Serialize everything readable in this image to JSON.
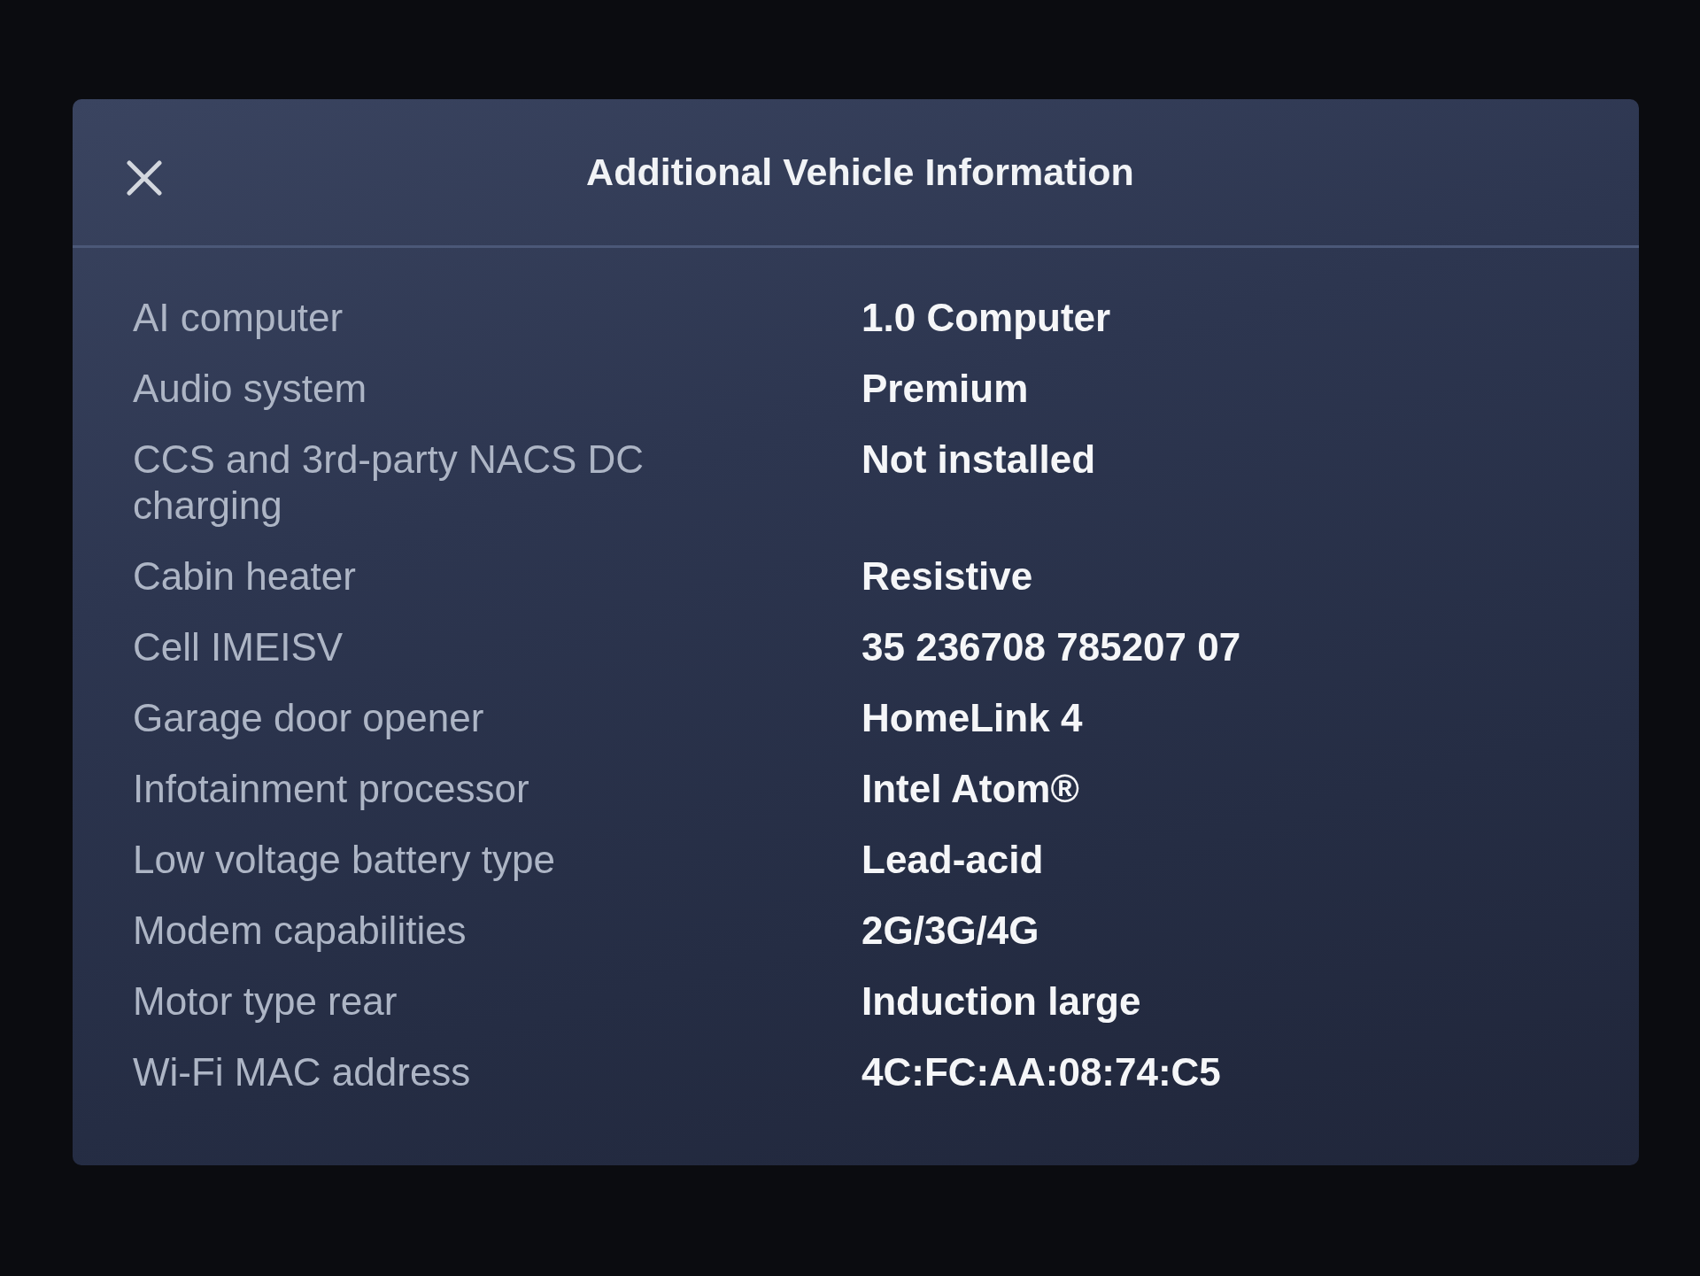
{
  "dialog": {
    "title": "Additional Vehicle Information",
    "rows": [
      {
        "label": "AI computer",
        "value": "1.0 Computer"
      },
      {
        "label": "Audio system",
        "value": "Premium"
      },
      {
        "label": "CCS and 3rd-party NACS DC charging",
        "value": "Not installed"
      },
      {
        "label": "Cabin heater",
        "value": "Resistive"
      },
      {
        "label": "Cell IMEISV",
        "value": "35 236708 785207 07"
      },
      {
        "label": "Garage door opener",
        "value": "HomeLink 4"
      },
      {
        "label": "Infotainment processor",
        "value": "Intel Atom®"
      },
      {
        "label": "Low voltage battery type",
        "value": "Lead-acid"
      },
      {
        "label": "Modem capabilities",
        "value": "2G/3G/4G"
      },
      {
        "label": "Motor type rear",
        "value": "Induction large"
      },
      {
        "label": "Wi-Fi MAC address",
        "value": "4C:FC:AA:08:74:C5"
      }
    ]
  }
}
